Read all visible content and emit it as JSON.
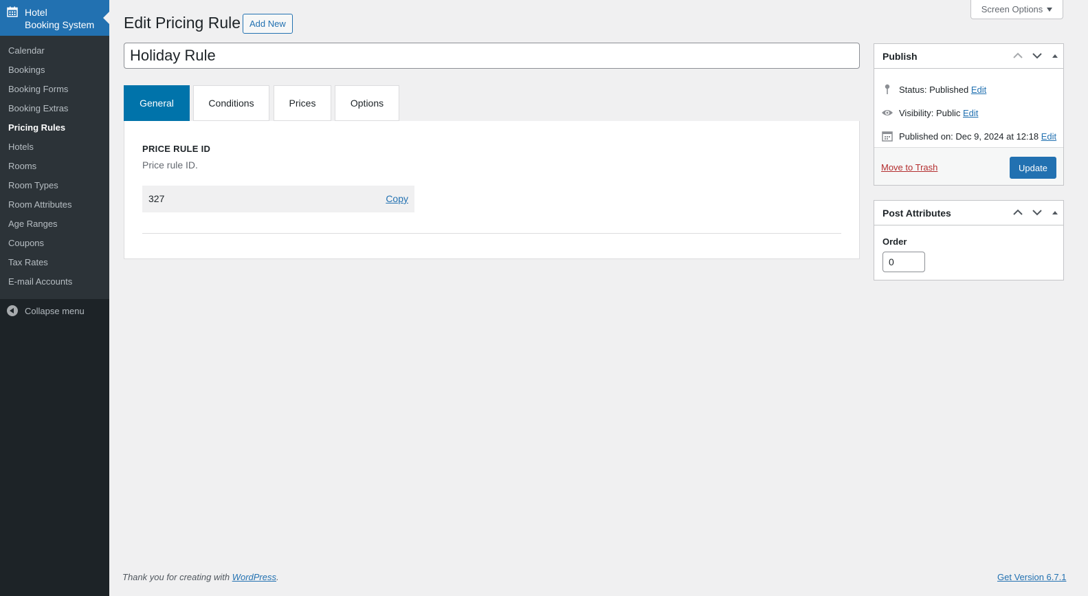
{
  "sidebar": {
    "brand_line1": "Hotel",
    "brand_line2": "Booking System",
    "items": [
      {
        "label": "Calendar"
      },
      {
        "label": "Bookings"
      },
      {
        "label": "Booking Forms"
      },
      {
        "label": "Booking Extras"
      },
      {
        "label": "Pricing Rules",
        "current": true
      },
      {
        "label": "Hotels"
      },
      {
        "label": "Rooms"
      },
      {
        "label": "Room Types"
      },
      {
        "label": "Room Attributes"
      },
      {
        "label": "Age Ranges"
      },
      {
        "label": "Coupons"
      },
      {
        "label": "Tax Rates"
      },
      {
        "label": "E-mail Accounts"
      }
    ],
    "collapse_label": "Collapse menu"
  },
  "header": {
    "screen_options": "Screen Options",
    "title": "Edit Pricing Rule",
    "add_new": "Add New"
  },
  "post_title": "Holiday Rule",
  "tabs": [
    {
      "label": "General",
      "active": true
    },
    {
      "label": "Conditions"
    },
    {
      "label": "Prices"
    },
    {
      "label": "Options"
    }
  ],
  "general": {
    "field_label": "PRICE RULE ID",
    "field_desc": "Price rule ID.",
    "id_value": "327",
    "copy_label": "Copy"
  },
  "publish": {
    "title": "Publish",
    "status_label": "Status: ",
    "status_value": "Published",
    "visibility_label": "Visibility: ",
    "visibility_value": "Public",
    "published_label": "Published on: ",
    "published_value": "Dec 9, 2024 at 12:18",
    "edit_label": "Edit",
    "trash_label": "Move to Trash",
    "update_label": "Update"
  },
  "attributes": {
    "title": "Post Attributes",
    "order_label": "Order",
    "order_value": "0"
  },
  "footer": {
    "thanks_prefix": "Thank you for creating with ",
    "wp_link": "WordPress",
    "thanks_suffix": ".",
    "version": "Get Version 6.7.1"
  },
  "colors": {
    "accent": "#2271b1",
    "tab_active": "#0073aa",
    "sidebar_bg": "#1d2327",
    "trash": "#b32d2e"
  }
}
